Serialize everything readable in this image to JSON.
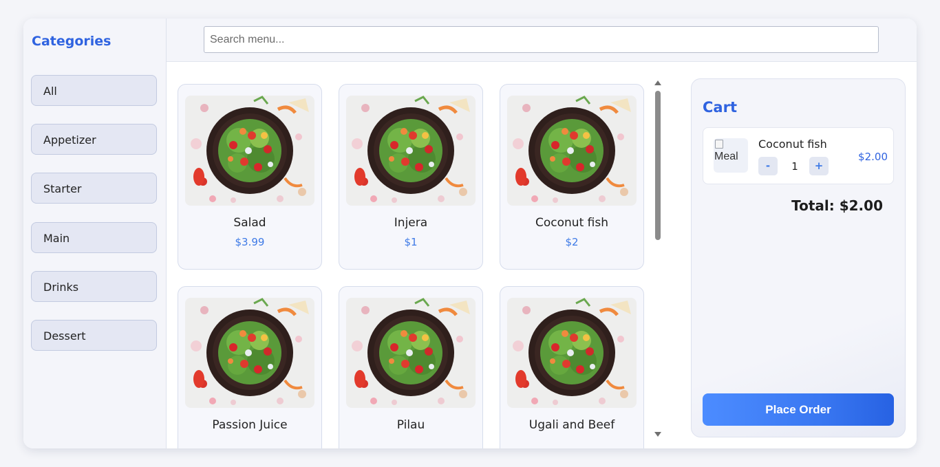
{
  "sidebar": {
    "title": "Categories",
    "categories": [
      "All",
      "Appetizer",
      "Starter",
      "Main",
      "Drinks",
      "Dessert"
    ]
  },
  "search": {
    "placeholder": "Search menu...",
    "value": ""
  },
  "menu": {
    "items": [
      {
        "name": "Salad",
        "price": "$3.99"
      },
      {
        "name": "Injera",
        "price": "$1"
      },
      {
        "name": "Coconut fish",
        "price": "$2"
      },
      {
        "name": "Passion Juice",
        "price": ""
      },
      {
        "name": "Pilau",
        "price": ""
      },
      {
        "name": "Ugali and Beef",
        "price": ""
      }
    ]
  },
  "cart": {
    "title": "Cart",
    "items": [
      {
        "name": "Coconut fish",
        "image_alt": "Meal",
        "quantity": "1",
        "price": "$2.00",
        "decrement_label": "-",
        "increment_label": "+"
      }
    ],
    "total": "Total: $2.00",
    "place_order_label": "Place Order"
  },
  "colors": {
    "accent": "#2f63e0",
    "price": "#3e7ae6",
    "button_gradient_start": "#4c8cff",
    "button_gradient_end": "#2762e3"
  }
}
